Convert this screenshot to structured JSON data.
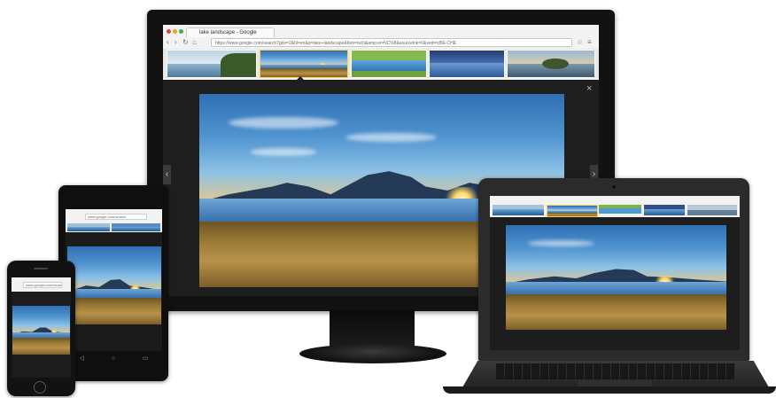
{
  "browser": {
    "tab_title": "lake landscape - Google",
    "url": "https://www.google.com/search?gbv=2&hl=en&q=lake+landscape&tbm=isch&amp;ei=NC%8&sourcelnk=0&ved=rd5E-CHE",
    "url_short": "www.google.com/search",
    "nav": {
      "back": "‹",
      "forward": "›",
      "reload": "↻",
      "home": "⌂",
      "star": "☆",
      "menu": "≡"
    }
  },
  "viewer": {
    "close_glyph": "×",
    "prev_glyph": "‹",
    "next_glyph": "›"
  },
  "tablet_nav": {
    "back": "◁",
    "home": "○",
    "recents": "▭"
  },
  "colors": {
    "device_body": "#121212",
    "chrome_bar": "#f2f2f2",
    "close_red": "#e0443e",
    "minimize_yellow": "#dba92a",
    "zoom_green": "#39b54a"
  }
}
